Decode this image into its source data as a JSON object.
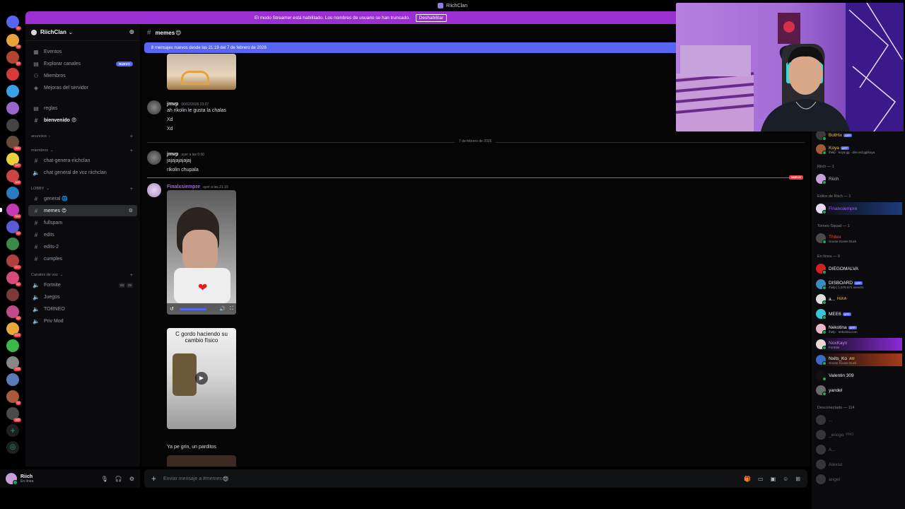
{
  "window": {
    "title": "RiichClan"
  },
  "banner": {
    "text": "El modo Streamer está habilitado. Los nombres de usuario se han truncado.",
    "button": "Deshabilitar"
  },
  "rail": {
    "badges": [
      "11",
      "18",
      "33",
      "201",
      "167",
      "102",
      "319",
      "42",
      "2",
      "1K+",
      "61",
      "42",
      "834",
      "399",
      "465",
      "98"
    ]
  },
  "sidebar": {
    "guild_name": "RiichClan",
    "top_items": [
      {
        "icon": "calendar-icon",
        "label": "Eventos"
      },
      {
        "icon": "compass-icon",
        "label": "Explorar canales",
        "badge": "NUEVO"
      },
      {
        "icon": "members-icon",
        "label": "Miembros"
      },
      {
        "icon": "boost-icon",
        "label": "Mejoras del servidor"
      }
    ],
    "rules": "reglas",
    "welcome": "bienvenido",
    "categories": {
      "anuncios": "anuncios",
      "miembros": "miembros",
      "lobby": "LOBBY",
      "voice": "Canales de voz"
    },
    "miembros_channels": [
      "chat-genera-riichclan",
      "chat general de voz riichclan"
    ],
    "lobby_channels": [
      "general",
      "memes",
      "fullspam",
      "edits",
      "edits-2",
      "cumples"
    ],
    "voice_channels": [
      "Fortnite",
      "Juegos",
      "TORNEO",
      "Priv Mod"
    ],
    "voice_counts": [
      "00",
      "29"
    ]
  },
  "user_panel": {
    "name": "Riich",
    "status": "En línea"
  },
  "channel": {
    "name": "memes",
    "new_messages_bar": "8 mensajes nuevos desde las 21:19 del 7 de febrero de 2026"
  },
  "messages": [
    {
      "author": "jmvp",
      "time": "06/02/2026 23:07",
      "lines": [
        "ah rikolin le gusta la chalas",
        "Xd",
        "Xd"
      ]
    },
    {
      "author": "jmvp",
      "time": "ayer a las 0:00",
      "lines": [
        "jajajajajajaj",
        "rikolin chupala"
      ]
    },
    {
      "author": "Finalxsiempre",
      "time": "ayer a las 21:19",
      "caption_video": "C gordo haciendo su cambio físico",
      "caption_after": "Ya pe grin, un parditos"
    }
  ],
  "date_divider": "7 de febrero de 2026",
  "new_label": "NUEVO",
  "composer": {
    "placeholder": "Enviar mensaje a #memes"
  },
  "members": {
    "groups": [
      {
        "label": "Riich — 1",
        "members": [
          {
            "name": "Riich"
          }
        ]
      },
      {
        "label": "Editor de Riich — 1",
        "members": [
          {
            "name": "Finalxsiempre"
          }
        ]
      },
      {
        "label": "Torneo Squad — 1",
        "members": [
          {
            "name": "Thitex",
            "sub": "Goose Goose Duck"
          }
        ]
      },
      {
        "label": "En línea — 9",
        "members": [
          {
            "name": "DIEGOMALVA"
          },
          {
            "name": "DISBOARD",
            "app": "APP",
            "sub": "/help | 1,579,671 servers"
          },
          {
            "name": "a...",
            "tag": "FEKA"
          },
          {
            "name": "MEE6",
            "app": "APP"
          },
          {
            "name": "Nekotina",
            "app": "APP",
            "sub": "/help · nekotina.com"
          },
          {
            "name": "NoxKayn",
            "sub": "Fortnite"
          },
          {
            "name": "Nxits_Ko",
            "tag": "AM",
            "sub": "Goose Goose Duck"
          },
          {
            "name": "Valentin 309"
          },
          {
            "name": "yandel"
          }
        ]
      },
      {
        "label": "Desconectado — 114",
        "members": [
          {
            "name": "..."
          },
          {
            "name": "_ericgo",
            "tag": "PRO"
          },
          {
            "name": "A..."
          },
          {
            "name": "Alexso"
          },
          {
            "name": "angel"
          }
        ]
      }
    ],
    "top_members": [
      {
        "name": "BotHix",
        "app": "APP"
      },
      {
        "name": "Koya",
        "app": "APP",
        "sub": "/help · koya.gg · discord.gg/koya"
      }
    ]
  },
  "colors": {
    "accent": "#5865f2",
    "streamer_banner": "#9b2fd1",
    "online": "#23a55a",
    "new_line": "#f23f43",
    "editor_name": "#b15bf0"
  }
}
